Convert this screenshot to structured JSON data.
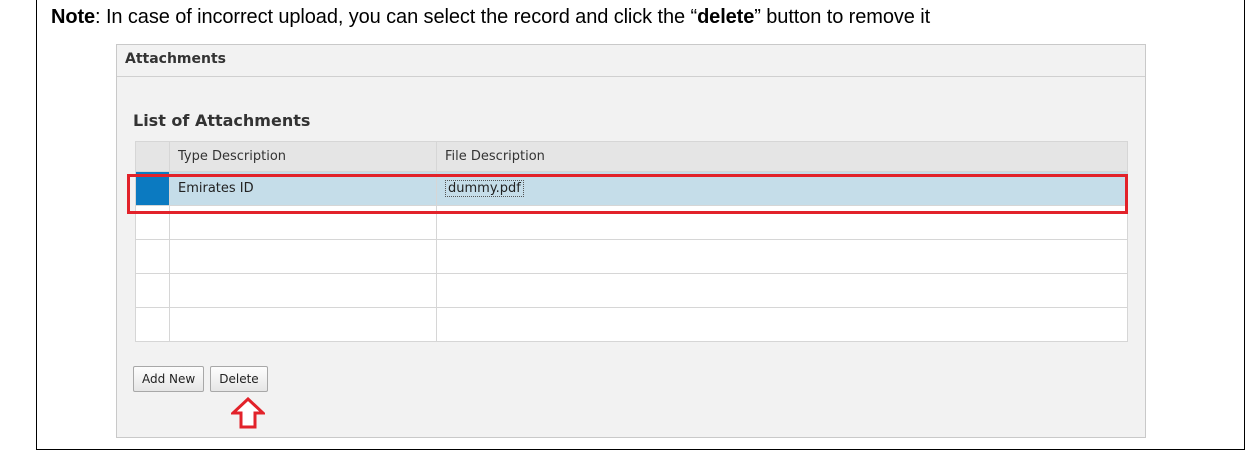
{
  "note": {
    "prefix": "Note",
    "text_before": ": In case of incorrect upload, you can select the record and click the “",
    "keyword": "delete",
    "text_after": "” button to remove it"
  },
  "panel": {
    "header": "Attachments",
    "list_title": "List of Attachments"
  },
  "table": {
    "columns": [
      "Type Description",
      "File Description"
    ],
    "rows": [
      {
        "type": "Emirates ID",
        "file": "dummy.pdf",
        "selected": true
      },
      {
        "type": "",
        "file": "",
        "selected": false
      },
      {
        "type": "",
        "file": "",
        "selected": false
      },
      {
        "type": "",
        "file": "",
        "selected": false
      },
      {
        "type": "",
        "file": "",
        "selected": false
      }
    ]
  },
  "buttons": {
    "add_new": "Add New",
    "delete": "Delete"
  },
  "colors": {
    "highlight": "#e2222a",
    "selected_row": "#c5dde9",
    "selected_marker": "#0b7ac1"
  },
  "icons": {
    "pointer": "up-arrow-icon"
  }
}
